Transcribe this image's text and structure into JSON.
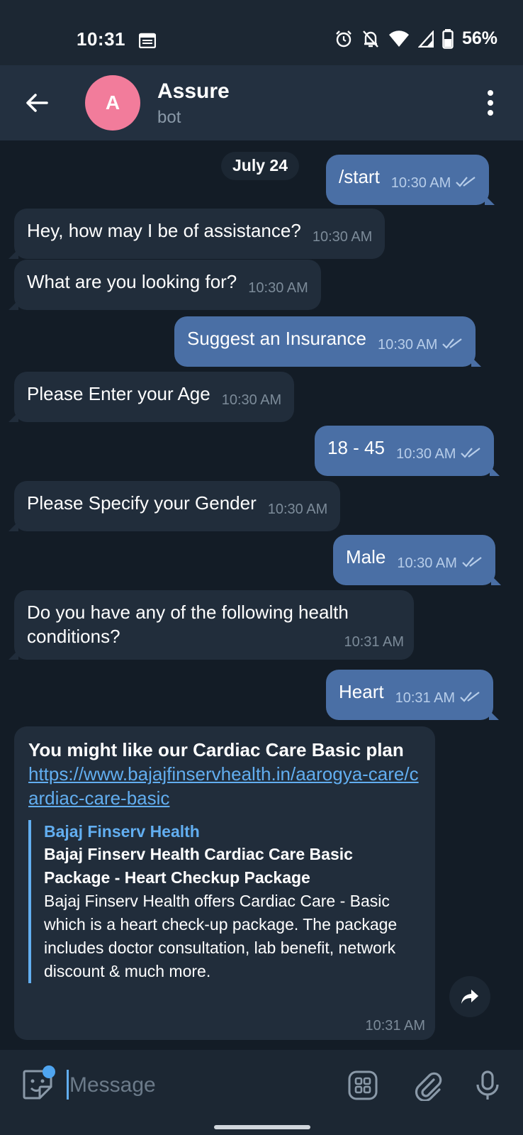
{
  "status_bar": {
    "time": "10:31",
    "battery": "56%",
    "icons": [
      "calendar-icon",
      "alarm-icon",
      "notifications-off-icon",
      "wifi-icon",
      "signal-icon",
      "battery-icon"
    ]
  },
  "header": {
    "avatar_letter": "A",
    "avatar_color": "#f27c9b",
    "title": "Assure",
    "subtitle": "bot"
  },
  "chat": {
    "date_chip": "July 24",
    "messages": [
      {
        "dir": "out",
        "text": "/start",
        "time": "10:30 AM",
        "read": true
      },
      {
        "dir": "in",
        "text": "Hey, how may I be of assistance?",
        "time": "10:30 AM"
      },
      {
        "dir": "in",
        "text": "What are you looking for?",
        "time": "10:30 AM"
      },
      {
        "dir": "out",
        "text": "Suggest an Insurance",
        "time": "10:30 AM",
        "read": true
      },
      {
        "dir": "in",
        "text": "Please Enter your Age",
        "time": "10:30 AM"
      },
      {
        "dir": "out",
        "text": "18 - 45",
        "time": "10:30 AM",
        "read": true
      },
      {
        "dir": "in",
        "text": "Please Specify your Gender",
        "time": "10:30 AM"
      },
      {
        "dir": "out",
        "text": "Male",
        "time": "10:30 AM",
        "read": true
      },
      {
        "dir": "in",
        "text": "Do you have any of the following health conditions?",
        "time": "10:31 AM"
      },
      {
        "dir": "out",
        "text": "Heart",
        "time": "10:31 AM",
        "read": true
      }
    ],
    "link_message": {
      "title": "You might like our Cardiac Care Basic plan",
      "url": "https://www.bajajfinservhealth.in/aarogya-care/cardiac-care-basic",
      "preview_site": "Bajaj Finserv Health",
      "preview_title": "Bajaj Finserv Health Cardiac Care Basic Package - Heart Checkup Package",
      "preview_description": "Bajaj Finserv Health offers Cardiac Care - Basic which is a heart check-up package. The package includes doctor consultation, lab benefit, network discount & much more.",
      "time": "10:31 AM"
    }
  },
  "input": {
    "placeholder": "Message"
  },
  "colors": {
    "background": "#131c26",
    "incoming_bubble": "#212d3b",
    "outgoing_bubble": "#4a6fa5",
    "link": "#62aef0"
  }
}
